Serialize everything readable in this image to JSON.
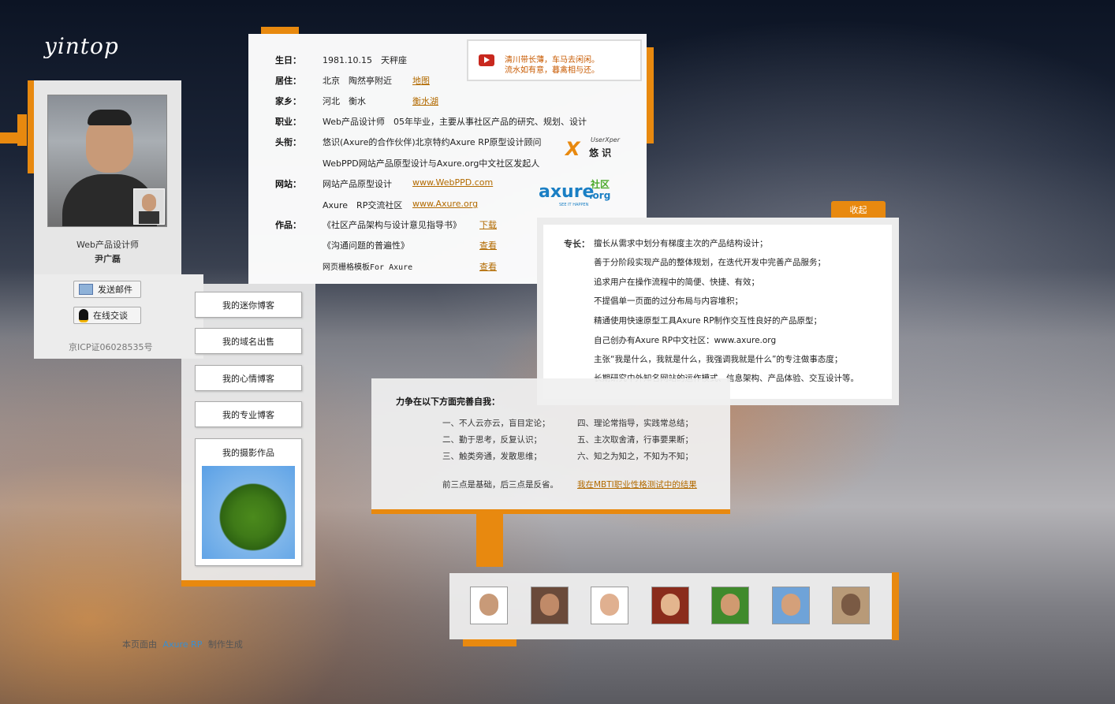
{
  "brand": {
    "logo": "yintop"
  },
  "profile": {
    "title": "Web产品设计师",
    "name": "尹广磊",
    "icp": "京ICP证06028535号"
  },
  "actions": {
    "email": "发送邮件",
    "chat": "在线交谈"
  },
  "blogs": [
    "我的迷你博客",
    "我的域名出售",
    "我的心情博客",
    "我的专业博客"
  ],
  "photo_title": "我的摄影作品",
  "info": {
    "birth_label": "生日：",
    "birth": "1981.10.15　天秤座",
    "live_label": "居住：",
    "live": "北京　陶然亭附近",
    "live_link": "地图",
    "home_label": "家乡：",
    "home": "河北　衡水",
    "home_link": "衡水湖",
    "job_label": "职业：",
    "job": "Web产品设计师　05年毕业，主要从事社区产品的研究、规划、设计",
    "title_label": "头衔：",
    "title1": "悠识(Axure的合作伙伴)北京特约Axure RP原型设计顾问",
    "title2": "WebPPD网站产品原型设计与Axure.org中文社区发起人",
    "web_label": "网站：",
    "web1": "网站产品原型设计",
    "web1_link": "www.WebPPD.com",
    "web2": "Axure　RP交流社区",
    "web2_link": "www.Axure.org",
    "works_label": "作品：",
    "works": [
      {
        "name": "《社区产品架构与设计意见指导书》",
        "link": "下载"
      },
      {
        "name": "《沟通问题的普遍性》",
        "link": "查看"
      },
      {
        "name": "网页栅格模板For Axure",
        "link": "查看"
      }
    ]
  },
  "quote": {
    "line1": "清川带长薄，车马去闲闲。",
    "line2": "流水如有意，暮禽相与还。"
  },
  "logos": {
    "userxper_en": "UserXper",
    "userxper_cn": "悠 识",
    "axure": "axure",
    "axure_cn": "社区",
    "axure_org": ".org",
    "axure_tag": "SEE IT HAPPEN"
  },
  "collapse": "收起",
  "skills": {
    "label": "专长：",
    "lines": [
      "擅长从需求中划分有梯度主次的产品结构设计；",
      "善于分阶段实现产品的整体规划，在迭代开发中完善产品服务；",
      "追求用户在操作流程中的简便、快捷、有效；",
      "不提倡单一页面的过分布局与内容堆积；",
      "精通使用快速原型工具Axure RP制作交互性良好的产品原型；",
      "自己创办有Axure RP中文社区：www.axure.org",
      "主张“我是什么，我就是什么，我强调我就是什么”的专注做事态度；",
      "长期研究中外知名网站的运作模式、信息架构、产品体验、交互设计等。"
    ]
  },
  "improve": {
    "title": "力争在以下方面完善自我：",
    "left": [
      "一、不人云亦云，盲目定论；",
      "二、勤于思考，反复认识；",
      "三、触类旁通，发散思维；"
    ],
    "right": [
      "四、理论常指导，实践常总结；",
      "五、主次取舍清，行事要果断；",
      "六、知之为知之，不知为不知；"
    ],
    "summary": "前三点是基础，后三点是反省。",
    "link": "我在MBTI职业性格测试中的结果"
  },
  "footer": {
    "pre": "本页面由",
    "link": "Axure RP",
    "post": "制作生成"
  },
  "colors": {
    "accent": "#e8890f",
    "link": "#b26a00"
  }
}
